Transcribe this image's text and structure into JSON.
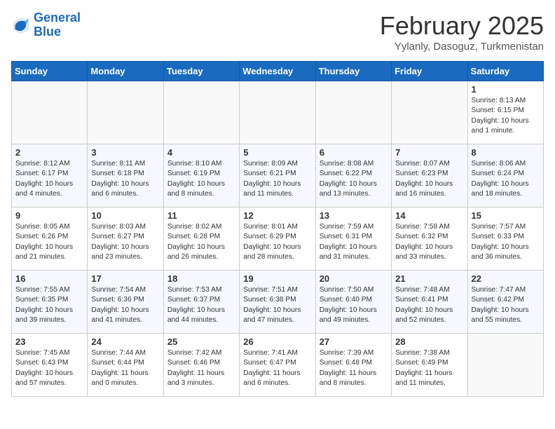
{
  "logo": {
    "text1": "General",
    "text2": "Blue"
  },
  "title": "February 2025",
  "subtitle": "Yylanly, Dasoguz, Turkmenistan",
  "days_of_week": [
    "Sunday",
    "Monday",
    "Tuesday",
    "Wednesday",
    "Thursday",
    "Friday",
    "Saturday"
  ],
  "weeks": [
    [
      {
        "day": "",
        "info": ""
      },
      {
        "day": "",
        "info": ""
      },
      {
        "day": "",
        "info": ""
      },
      {
        "day": "",
        "info": ""
      },
      {
        "day": "",
        "info": ""
      },
      {
        "day": "",
        "info": ""
      },
      {
        "day": "1",
        "info": "Sunrise: 8:13 AM\nSunset: 6:15 PM\nDaylight: 10 hours\nand 1 minute."
      }
    ],
    [
      {
        "day": "2",
        "info": "Sunrise: 8:12 AM\nSunset: 6:17 PM\nDaylight: 10 hours\nand 4 minutes."
      },
      {
        "day": "3",
        "info": "Sunrise: 8:11 AM\nSunset: 6:18 PM\nDaylight: 10 hours\nand 6 minutes."
      },
      {
        "day": "4",
        "info": "Sunrise: 8:10 AM\nSunset: 6:19 PM\nDaylight: 10 hours\nand 8 minutes."
      },
      {
        "day": "5",
        "info": "Sunrise: 8:09 AM\nSunset: 6:21 PM\nDaylight: 10 hours\nand 11 minutes."
      },
      {
        "day": "6",
        "info": "Sunrise: 8:08 AM\nSunset: 6:22 PM\nDaylight: 10 hours\nand 13 minutes."
      },
      {
        "day": "7",
        "info": "Sunrise: 8:07 AM\nSunset: 6:23 PM\nDaylight: 10 hours\nand 16 minutes."
      },
      {
        "day": "8",
        "info": "Sunrise: 8:06 AM\nSunset: 6:24 PM\nDaylight: 10 hours\nand 18 minutes."
      }
    ],
    [
      {
        "day": "9",
        "info": "Sunrise: 8:05 AM\nSunset: 6:26 PM\nDaylight: 10 hours\nand 21 minutes."
      },
      {
        "day": "10",
        "info": "Sunrise: 8:03 AM\nSunset: 6:27 PM\nDaylight: 10 hours\nand 23 minutes."
      },
      {
        "day": "11",
        "info": "Sunrise: 8:02 AM\nSunset: 6:28 PM\nDaylight: 10 hours\nand 26 minutes."
      },
      {
        "day": "12",
        "info": "Sunrise: 8:01 AM\nSunset: 6:29 PM\nDaylight: 10 hours\nand 28 minutes."
      },
      {
        "day": "13",
        "info": "Sunrise: 7:59 AM\nSunset: 6:31 PM\nDaylight: 10 hours\nand 31 minutes."
      },
      {
        "day": "14",
        "info": "Sunrise: 7:58 AM\nSunset: 6:32 PM\nDaylight: 10 hours\nand 33 minutes."
      },
      {
        "day": "15",
        "info": "Sunrise: 7:57 AM\nSunset: 6:33 PM\nDaylight: 10 hours\nand 36 minutes."
      }
    ],
    [
      {
        "day": "16",
        "info": "Sunrise: 7:55 AM\nSunset: 6:35 PM\nDaylight: 10 hours\nand 39 minutes."
      },
      {
        "day": "17",
        "info": "Sunrise: 7:54 AM\nSunset: 6:36 PM\nDaylight: 10 hours\nand 41 minutes."
      },
      {
        "day": "18",
        "info": "Sunrise: 7:53 AM\nSunset: 6:37 PM\nDaylight: 10 hours\nand 44 minutes."
      },
      {
        "day": "19",
        "info": "Sunrise: 7:51 AM\nSunset: 6:38 PM\nDaylight: 10 hours\nand 47 minutes."
      },
      {
        "day": "20",
        "info": "Sunrise: 7:50 AM\nSunset: 6:40 PM\nDaylight: 10 hours\nand 49 minutes."
      },
      {
        "day": "21",
        "info": "Sunrise: 7:48 AM\nSunset: 6:41 PM\nDaylight: 10 hours\nand 52 minutes."
      },
      {
        "day": "22",
        "info": "Sunrise: 7:47 AM\nSunset: 6:42 PM\nDaylight: 10 hours\nand 55 minutes."
      }
    ],
    [
      {
        "day": "23",
        "info": "Sunrise: 7:45 AM\nSunset: 6:43 PM\nDaylight: 10 hours\nand 57 minutes."
      },
      {
        "day": "24",
        "info": "Sunrise: 7:44 AM\nSunset: 6:44 PM\nDaylight: 11 hours\nand 0 minutes."
      },
      {
        "day": "25",
        "info": "Sunrise: 7:42 AM\nSunset: 6:46 PM\nDaylight: 11 hours\nand 3 minutes."
      },
      {
        "day": "26",
        "info": "Sunrise: 7:41 AM\nSunset: 6:47 PM\nDaylight: 11 hours\nand 6 minutes."
      },
      {
        "day": "27",
        "info": "Sunrise: 7:39 AM\nSunset: 6:48 PM\nDaylight: 11 hours\nand 8 minutes."
      },
      {
        "day": "28",
        "info": "Sunrise: 7:38 AM\nSunset: 6:49 PM\nDaylight: 11 hours\nand 11 minutes."
      },
      {
        "day": "",
        "info": ""
      }
    ]
  ]
}
